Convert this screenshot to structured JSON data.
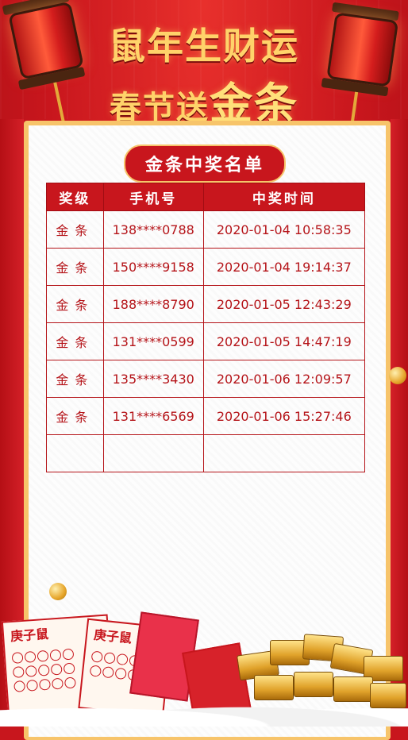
{
  "headline": {
    "line1": "鼠年生财运",
    "line2_prefix": "春节送",
    "line2_highlight": "金条"
  },
  "card": {
    "banner": "金条中奖名单"
  },
  "table": {
    "headers": [
      "奖级",
      "手机号",
      "中奖时间"
    ],
    "rows": [
      {
        "level": "金条",
        "phone": "138****0788",
        "time": "2020-01-04 10:58:35"
      },
      {
        "level": "金条",
        "phone": "150****9158",
        "time": "2020-01-04 19:14:37"
      },
      {
        "level": "金条",
        "phone": "188****8790",
        "time": "2020-01-05 12:43:29"
      },
      {
        "level": "金条",
        "phone": "131****0599",
        "time": "2020-01-05 14:47:19"
      },
      {
        "level": "金条",
        "phone": "135****3430",
        "time": "2020-01-06 12:09:57"
      },
      {
        "level": "金条",
        "phone": "131****6569",
        "time": "2020-01-06 15:27:46"
      },
      {
        "level": "",
        "phone": "",
        "time": ""
      }
    ]
  },
  "decor": {
    "ticket_title_1": "庚子鼠",
    "ticket_title_2": "庚子鼠"
  },
  "colors": {
    "primary_red": "#c8161d",
    "gold": "#ffd36a"
  }
}
